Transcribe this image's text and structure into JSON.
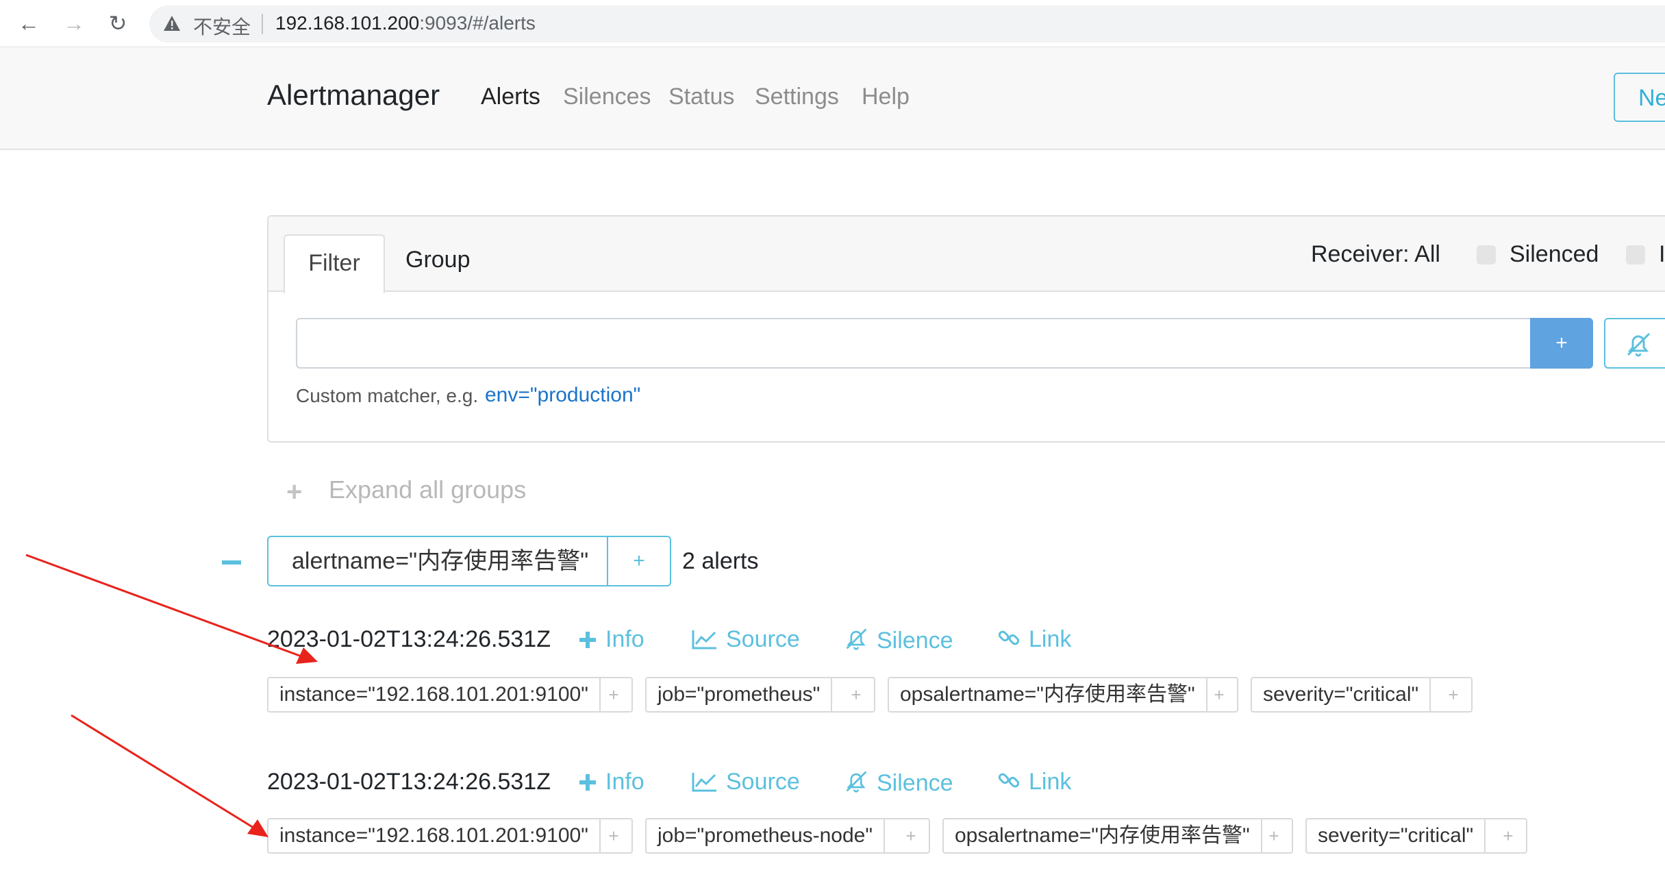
{
  "browser": {
    "security_label": "不安全",
    "url_host": "192.168.101.200",
    "url_rest": ":9093/#/alerts"
  },
  "navbar": {
    "brand": "Alertmanager",
    "links": [
      "Alerts",
      "Silences",
      "Status",
      "Settings",
      "Help"
    ],
    "active_link": "Alerts",
    "new_silence_partial": "Ne"
  },
  "filter_card": {
    "tabs": [
      "Filter",
      "Group"
    ],
    "receiver": "Receiver: All",
    "silenced_label": "Silenced",
    "inhibited_partial": "I",
    "filter_input_value": "",
    "add_button": "+",
    "hint_text": "Custom matcher, e.g.",
    "hint_example": "env=\"production\""
  },
  "expand_all": {
    "icon": "+",
    "label": "Expand all groups"
  },
  "group": {
    "label": "alertname=\"内存使用率告警\"",
    "add": "+",
    "count": "2 alerts"
  },
  "actions": {
    "info": "Info",
    "source": "Source",
    "silence": "Silence",
    "link": "Link"
  },
  "alerts": [
    {
      "timestamp": "2023-01-02T13:24:26.531Z",
      "labels": [
        "instance=\"192.168.101.201:9100\"",
        "job=\"prometheus\"",
        "opsalertname=\"内存使用率告警\"",
        "severity=\"critical\""
      ]
    },
    {
      "timestamp": "2023-01-02T13:24:26.531Z",
      "labels": [
        "instance=\"192.168.101.201:9100\"",
        "job=\"prometheus-node\"",
        "opsalertname=\"内存使用率告警\"",
        "severity=\"critical\""
      ]
    }
  ],
  "label_add": "+",
  "colors": {
    "accent": "#5bc0de",
    "primary_button": "#5fa3e0",
    "annotation_arrow": "#e8231b"
  }
}
